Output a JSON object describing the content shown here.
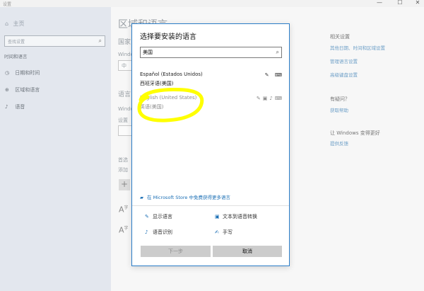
{
  "window": {
    "app_title": "设置",
    "controls": {
      "minimize": "—",
      "maximize": "☐",
      "close": "✕"
    }
  },
  "sidebar": {
    "home": {
      "icon": "home-icon",
      "label": "主页"
    },
    "search_placeholder": "查找设置",
    "section": "时间和语言",
    "items": [
      {
        "icon": "calendar-clock-icon",
        "label": "日期和时间"
      },
      {
        "icon": "globe-icon",
        "label": "区域和语言"
      },
      {
        "icon": "microphone-icon",
        "label": "语音"
      }
    ]
  },
  "content": {
    "title": "区域和语言",
    "fragments": [
      "国家",
      "Windo",
      "中",
      "语言",
      "Windo",
      "设置",
      "首选",
      "添加"
    ],
    "glyph_a": "A",
    "glyph_zi": "字",
    "related": {
      "title": "相关设置",
      "links": [
        "其他日期、时间和区域设置",
        "管理语言设置",
        "高级键盘设置"
      ]
    },
    "question": {
      "title": "有疑问？",
      "link": "获取帮助"
    },
    "improve": {
      "title": "让 Windows 变得更好",
      "link": "提供反馈"
    }
  },
  "dialog": {
    "title": "选择要安装的语言",
    "search_value": "美国",
    "languages": [
      {
        "name": "Español (Estados Unidos)",
        "native": "西班牙语(美国)",
        "features": [
          "pen-icon",
          "keyboard-icon"
        ]
      },
      {
        "name": "English (United States)",
        "native": "英语(美国)",
        "features": [
          "pen-icon",
          "text-to-speech-icon",
          "microphone-icon",
          "keyboard-icon"
        ]
      }
    ],
    "store_link": "在 Microsoft Store 中免费获得更多语言",
    "legend": {
      "display": "显示语言",
      "tts": "文本到语音转换",
      "speech": "语音识别",
      "handwriting": "手写"
    },
    "buttons": {
      "next": "下一步",
      "cancel": "取消"
    },
    "colors": {
      "accent": "#2b7dc8",
      "highlight": "#ffff00"
    }
  }
}
